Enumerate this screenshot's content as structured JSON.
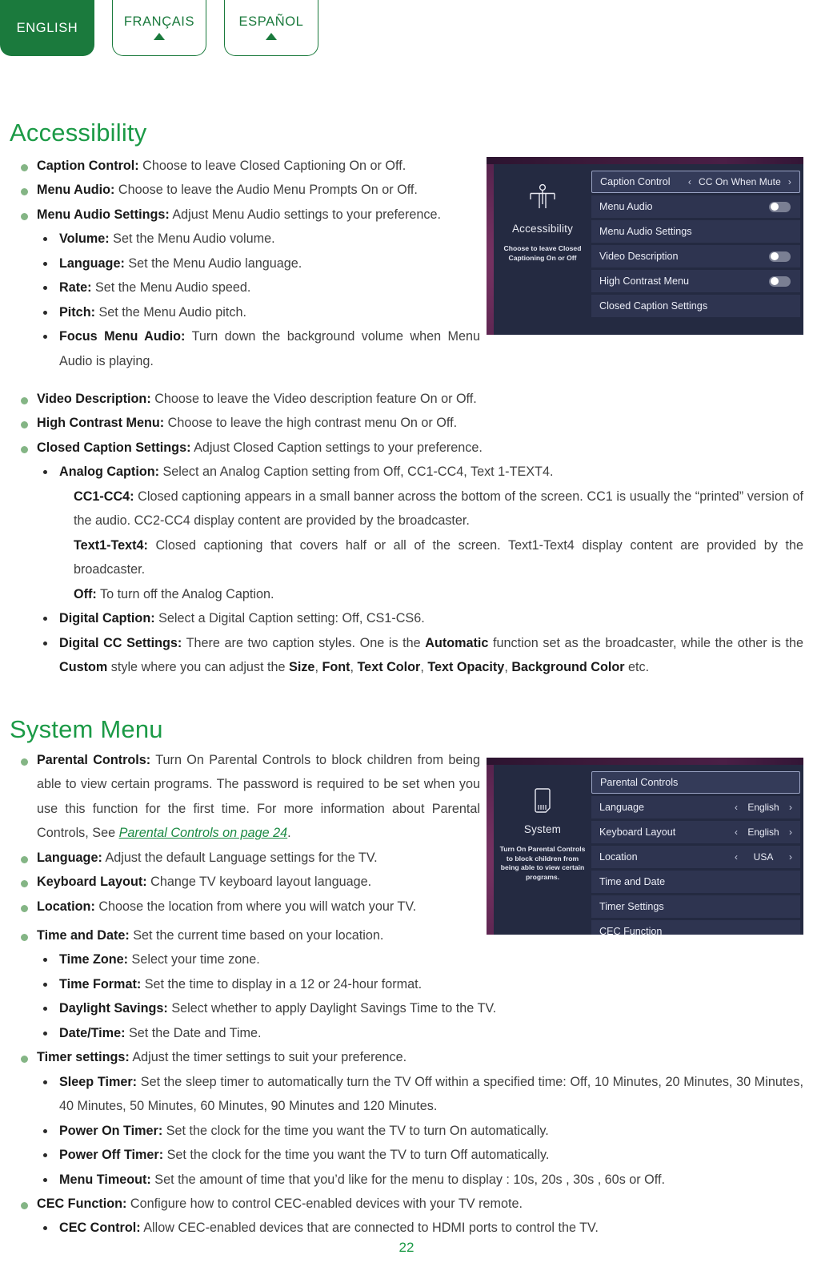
{
  "language_tabs": [
    {
      "label": "ENGLISH",
      "active": true,
      "has_arrow": false
    },
    {
      "label": "FRANÇAIS",
      "active": false,
      "has_arrow": true
    },
    {
      "label": "ESPAÑOL",
      "active": false,
      "has_arrow": true
    }
  ],
  "accessibility": {
    "title": "Accessibility",
    "items": [
      {
        "term": "Caption Control:",
        "text": " Choose to leave Closed Captioning On or Off."
      },
      {
        "term": "Menu Audio:",
        "text": " Choose to leave the Audio Menu Prompts On or Off."
      },
      {
        "term": "Menu Audio Settings:",
        "text": " Adjust Menu Audio settings to your preference."
      },
      {
        "term": "Volume:",
        "text": " Set the Menu Audio volume."
      },
      {
        "term": "Language:",
        "text": " Set the Menu Audio language."
      },
      {
        "term": "Rate:",
        "text": " Set the Menu Audio speed."
      },
      {
        "term": "Pitch:",
        "text": " Set the Menu Audio pitch."
      },
      {
        "term": "Focus Menu Audio:",
        "text": " Turn down the background volume when Menu Audio is playing."
      },
      {
        "term": "Video Description:",
        "text": " Choose to leave the Video description feature On or Off."
      },
      {
        "term": "High Contrast Menu:",
        "text": " Choose to leave the high contrast menu On or Off."
      },
      {
        "term": "Closed Caption Settings:",
        "text": " Adjust Closed Caption settings to your preference."
      },
      {
        "term": "Analog Caption:",
        "text": " Select an Analog Caption setting from Off, CC1-CC4, Text 1-TEXT4."
      },
      {
        "term": "CC1-CC4:",
        "text": " Closed captioning appears in a small banner across the bottom of the screen. CC1 is usually the “printed” version of the audio. CC2-CC4 display content are provided by the broadcaster."
      },
      {
        "term": "Text1-Text4:",
        "text": " Closed captioning that covers half or all of the screen. Text1-Text4 display content are provided by the broadcaster."
      },
      {
        "term": "Off:",
        "text": " To turn off the Analog Caption."
      },
      {
        "term": "Digital Caption:",
        "text": " Select a Digital Caption setting: Off, CS1-CS6."
      }
    ],
    "digital_cc": {
      "term": "Digital CC Settings:",
      "part1": " There are two caption styles. One is the ",
      "bold1": "Automatic",
      "part2": " function set as the broadcaster, while the other is the ",
      "bold2": "Custom",
      "part3": " style where you can adjust the ",
      "bold3": "Size",
      "sep1": ", ",
      "bold4": "Font",
      "sep2": ", ",
      "bold5": "Text Color",
      "sep3": ", ",
      "bold6": "Text Opacity",
      "sep4": ", ",
      "bold7": "Background Color",
      "part4": " etc."
    }
  },
  "accessibility_tv": {
    "category": "Accessibility",
    "category_desc": "Choose to leave Closed Captioning On or Off",
    "icon": "accessibility-person-icon",
    "rows": [
      {
        "label": "Caption Control",
        "value": "CC On When Mute",
        "control": "stepper",
        "highlight": true
      },
      {
        "label": "Menu Audio",
        "control": "toggle",
        "toggle_state": "off",
        "highlight": false
      },
      {
        "label": "Menu Audio Settings",
        "control": "none",
        "highlight": false
      },
      {
        "label": "Video Description",
        "control": "toggle",
        "toggle_state": "off",
        "highlight": false
      },
      {
        "label": "High Contrast Menu",
        "control": "toggle",
        "toggle_state": "off",
        "highlight": false
      },
      {
        "label": "Closed Caption Settings",
        "control": "none",
        "highlight": false
      }
    ]
  },
  "system": {
    "title": "System Menu",
    "parental": {
      "term": "Parental Controls:",
      "text": " Turn On Parental Controls to block children from being able to view certain programs. The password is required to be set when you use this function for the first time. For more information about Parental Controls, See ",
      "link": "Parental Controls on page 24",
      "tail": "."
    },
    "items": [
      {
        "term": "Language:",
        "text": " Adjust the default Language settings for the TV."
      },
      {
        "term": "Keyboard Layout:",
        "text": "  Change TV keyboard layout language."
      },
      {
        "term": "Location:",
        "text": " Choose the location from where you will watch your TV."
      },
      {
        "term": "Time and Date:",
        "text": " Set the current time based on your location."
      },
      {
        "term": "Time Zone:",
        "text": " Select your time zone."
      },
      {
        "term": "Time Format:",
        "text": " Set the time to display in a 12 or 24-hour format."
      },
      {
        "term": "Daylight Savings:",
        "text": " Select whether to apply Daylight Savings Time to the TV."
      },
      {
        "term": "Date/Time:",
        "text": " Set the Date and Time."
      },
      {
        "term": "Timer settings:",
        "text": " Adjust the timer settings to suit your preference."
      },
      {
        "term": "Sleep Timer:",
        "text": " Set the sleep timer to automatically turn the TV Off within a specified time: Off, 10 Minutes, 20 Minutes, 30 Minutes, 40 Minutes, 50 Minutes, 60 Minutes, 90 Minutes and 120 Minutes."
      },
      {
        "term": "Power On Timer:",
        "text": " Set the clock for the time you want the TV to turn On automatically."
      },
      {
        "term": "Power Off Timer:",
        "text": " Set the clock for the time you want the TV to turn Off automatically."
      },
      {
        "term": "Menu Timeout:",
        "text": " Set the amount of time that you’d like for the menu to display : 10s, 20s , 30s , 60s or Off."
      },
      {
        "term": "CEC Function:",
        "text": " Configure how to control CEC-enabled devices with your TV remote."
      },
      {
        "term": "CEC Control:",
        "text": " Allow CEC-enabled devices that are connected to HDMI ports to control the TV."
      }
    ]
  },
  "system_tv": {
    "category": "System",
    "category_desc": "Turn On Parental Controls to block children from being able to view certain programs.",
    "icon": "system-device-icon",
    "rows": [
      {
        "label": "Parental Controls",
        "control": "none",
        "highlight": true
      },
      {
        "label": "Language",
        "value": "English",
        "control": "stepper",
        "highlight": false
      },
      {
        "label": "Keyboard Layout",
        "value": "English",
        "control": "stepper",
        "highlight": false
      },
      {
        "label": "Location",
        "value": "USA",
        "control": "stepper",
        "highlight": false
      },
      {
        "label": "Time and Date",
        "control": "none",
        "highlight": false
      },
      {
        "label": "Timer Settings",
        "control": "none",
        "highlight": false
      },
      {
        "label": "CEC Function",
        "control": "none",
        "highlight": false,
        "clipped": true
      }
    ]
  },
  "page_number": "22",
  "colors": {
    "brand_green": "#1b9a46",
    "tab_green": "#1b7a3d",
    "bullet_green": "#84b585",
    "tv_panel": "#242a41",
    "tv_row": "#2e3450",
    "tv_backdrop": "#5b2550"
  }
}
